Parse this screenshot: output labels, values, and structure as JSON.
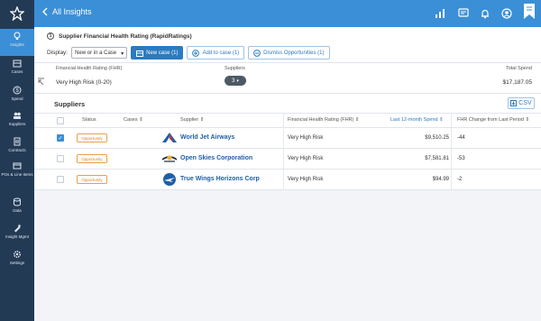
{
  "nav": {
    "items": [
      {
        "label": "Insights",
        "icon": "lightbulb-icon",
        "active": true
      },
      {
        "label": "Cases",
        "icon": "cases-icon",
        "active": false
      },
      {
        "label": "Spend",
        "icon": "spend-icon",
        "active": false
      },
      {
        "label": "Suppliers",
        "icon": "suppliers-icon",
        "active": false
      },
      {
        "label": "Contracts",
        "icon": "contracts-icon",
        "active": false
      },
      {
        "label": "POs & Line Items",
        "icon": "po-icon",
        "active": false
      },
      {
        "label": "Data",
        "icon": "data-icon",
        "active": false
      },
      {
        "label": "Insight Mgmt",
        "icon": "insight-mgmt-icon",
        "active": false
      },
      {
        "label": "Settings",
        "icon": "settings-icon",
        "active": false
      }
    ]
  },
  "topbar": {
    "back_label": "All Insights",
    "icons": [
      "bar-chart-icon",
      "chat-icon",
      "bell-icon",
      "user-icon",
      "bookmark-icon"
    ]
  },
  "header": {
    "title": "Supplier Financial Health Rating (RapidRatings)",
    "display_label": "Display:",
    "display_value": "New or in a Case",
    "new_case_label": "New case (1)",
    "add_to_case_label": "Add to case (1)",
    "dismiss_label": "Dismiss Opportunities (1)"
  },
  "summary": {
    "fhr_label": "Financial Health Rating (FHR)",
    "fhr_value": "Very High Risk (0-20)",
    "suppliers_label": "Suppliers",
    "suppliers_count": "3",
    "total_spend_label": "Total Spend",
    "total_spend_value": "$17,187.05"
  },
  "suppliers": {
    "title": "Suppliers",
    "csv_label": "CSV",
    "columns": {
      "status": "Status",
      "cases": "Cases",
      "supplier": "Supplier",
      "fhr": "Financial Health Rating (FHR)",
      "spend": "Last 12-month Spend",
      "change": "FHR Change from Last Period"
    },
    "rows": [
      {
        "checked": true,
        "status": "Opportunity",
        "supplier": "World Jet Airways",
        "logo": "world-jet-logo",
        "fhr": "Very High Risk",
        "spend": "$9,510.25",
        "change": "-44"
      },
      {
        "checked": false,
        "status": "Opportunity",
        "supplier": "Open Skies Corporation",
        "logo": "open-skies-logo",
        "fhr": "Very High Risk",
        "spend": "$7,581.81",
        "change": "-53"
      },
      {
        "checked": false,
        "status": "Opportunity",
        "supplier": "True Wings Horizons Corp",
        "logo": "true-wings-logo",
        "fhr": "Very High Risk",
        "spend": "$94.99",
        "change": "-2"
      }
    ]
  },
  "colors": {
    "accent": "#3b8fd6",
    "nav_bg": "#233a55",
    "opportunity": "#d9822b",
    "supplier_link": "#1f5fa8"
  }
}
